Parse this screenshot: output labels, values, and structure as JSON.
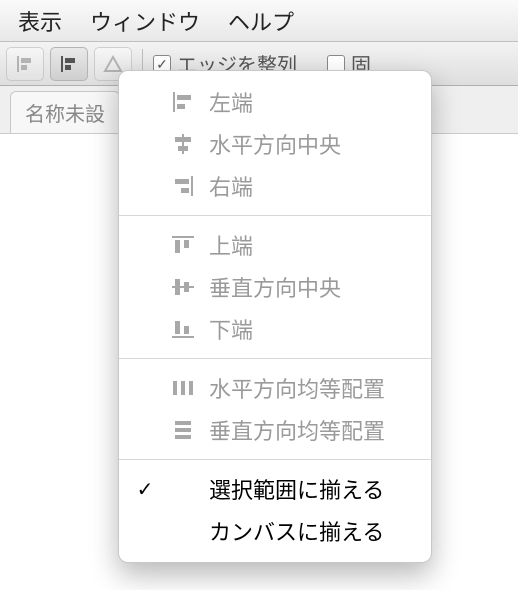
{
  "menubar": {
    "items": [
      "表示",
      "ウィンドウ",
      "ヘルプ"
    ]
  },
  "toolbar": {
    "edge_label": "エッジを整列",
    "fixed_label": "固"
  },
  "tab": {
    "title": "名称未設"
  },
  "menu": {
    "group1": [
      {
        "label": "左端",
        "icon": "align-left"
      },
      {
        "label": "水平方向中央",
        "icon": "align-hcenter"
      },
      {
        "label": "右端",
        "icon": "align-right"
      }
    ],
    "group2": [
      {
        "label": "上端",
        "icon": "align-top"
      },
      {
        "label": "垂直方向中央",
        "icon": "align-vcenter"
      },
      {
        "label": "下端",
        "icon": "align-bottom"
      }
    ],
    "group3": [
      {
        "label": "水平方向均等配置",
        "icon": "distribute-h"
      },
      {
        "label": "垂直方向均等配置",
        "icon": "distribute-v"
      }
    ],
    "group4": [
      {
        "label": "選択範囲に揃える",
        "checked": true,
        "enabled": true
      },
      {
        "label": "カンバスに揃える",
        "checked": false,
        "enabled": true
      }
    ]
  }
}
